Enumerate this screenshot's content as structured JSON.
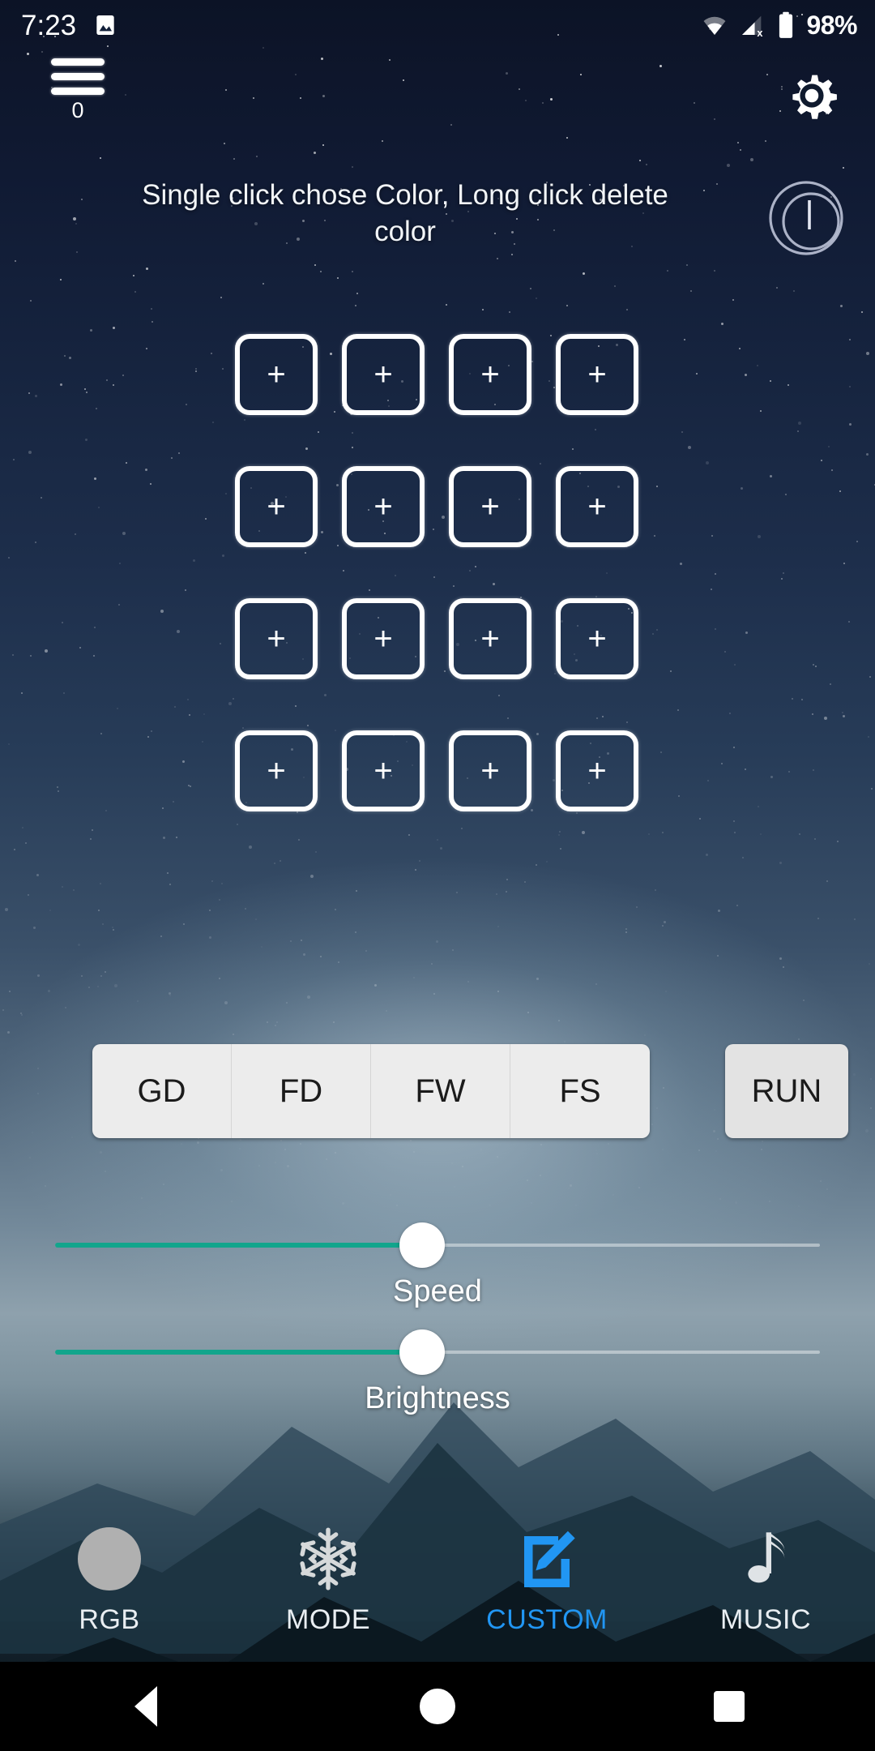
{
  "status_bar": {
    "time": "7:23",
    "battery_percent": "98%",
    "icons": [
      "image-icon",
      "wifi-icon",
      "cellular-no-sim-icon",
      "battery-full-icon"
    ]
  },
  "top_bar": {
    "menu_icon": "hamburger-menu-icon",
    "menu_count": "0",
    "settings_icon": "gear-icon"
  },
  "hint": {
    "text": "Single click chose Color, Long click delete color"
  },
  "power": {
    "icon": "power-icon"
  },
  "color_grid": {
    "rows": 4,
    "columns": 4,
    "slot_label": "+",
    "slots": [
      {
        "label": "+",
        "filled": false
      },
      {
        "label": "+",
        "filled": false
      },
      {
        "label": "+",
        "filled": false
      },
      {
        "label": "+",
        "filled": false
      },
      {
        "label": "+",
        "filled": false
      },
      {
        "label": "+",
        "filled": false
      },
      {
        "label": "+",
        "filled": false
      },
      {
        "label": "+",
        "filled": false
      },
      {
        "label": "+",
        "filled": false
      },
      {
        "label": "+",
        "filled": false
      },
      {
        "label": "+",
        "filled": false
      },
      {
        "label": "+",
        "filled": false
      },
      {
        "label": "+",
        "filled": false
      },
      {
        "label": "+",
        "filled": false
      },
      {
        "label": "+",
        "filled": false
      },
      {
        "label": "+",
        "filled": false
      }
    ]
  },
  "actions": {
    "segmented": [
      {
        "label": "GD"
      },
      {
        "label": "FD"
      },
      {
        "label": "FW"
      },
      {
        "label": "FS"
      }
    ],
    "run_label": "RUN"
  },
  "sliders": [
    {
      "label": "Speed",
      "value_percent": 48,
      "accent": "#12a58c"
    },
    {
      "label": "Brightness",
      "value_percent": 48,
      "accent": "#12a58c"
    }
  ],
  "bottom_nav": {
    "active_color": "#2196f3",
    "items": [
      {
        "label": "RGB",
        "icon": "color-circle-icon",
        "active": false
      },
      {
        "label": "MODE",
        "icon": "snowflake-icon",
        "active": false
      },
      {
        "label": "CUSTOM",
        "icon": "edit-pencil-icon",
        "active": true
      },
      {
        "label": "MUSIC",
        "icon": "music-note-icon",
        "active": false
      }
    ]
  },
  "system_nav": {
    "back": "back-triangle-icon",
    "home": "home-circle-icon",
    "recents": "recents-square-icon"
  }
}
